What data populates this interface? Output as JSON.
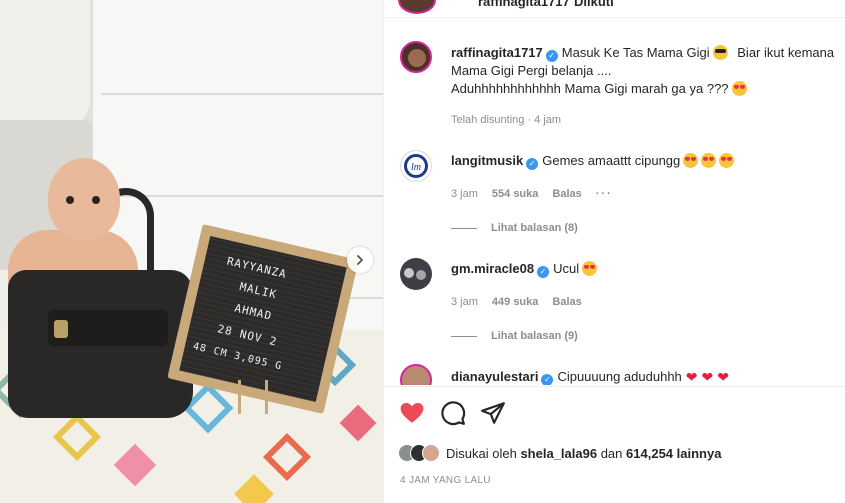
{
  "header": {
    "username": "raffinagita1717",
    "follow_state": "Diikuti"
  },
  "photo": {
    "board_lines": [
      "RAYYANZA",
      "MALIK",
      "AHMAD",
      "28 NOV 2",
      "48 CM   3,095 G"
    ]
  },
  "caption": {
    "username": "raffinagita1717",
    "line1": "Masuk Ke Tas Mama Gigi",
    "line1b": "Biar ikut kemana",
    "line2": "Mama Gigi Pergi belanja ....",
    "line3": "Aduhhhhhhhhhhhh Mama Gigi marah ga ya ???",
    "meta": "Telah disunting · 4 jam"
  },
  "comments": [
    {
      "username": "langitmusik",
      "text": "Gemes amaattt cipungg",
      "time": "3 jam",
      "likes": "554 suka",
      "reply_label": "Balas",
      "view_replies": "Lihat balasan (8)"
    },
    {
      "username": "gm.miracle08",
      "text": "Ucul",
      "time": "3 jam",
      "likes": "449 suka",
      "reply_label": "Balas",
      "view_replies": "Lihat balasan (9)"
    },
    {
      "username": "dianayulestari",
      "text": "Cipuuuung aduduhhh"
    }
  ],
  "actions": {
    "like_icon": "heart-filled-icon",
    "comment_icon": "comment-bubble-icon",
    "share_icon": "paper-plane-icon",
    "liked_by_prefix": "Disukai oleh",
    "liked_by_user": "shela_lala96",
    "liked_by_and": "dan",
    "liked_by_count": "614,254 lainnya",
    "time_ago": "4 JAM YANG LALU"
  },
  "colors": {
    "like_red": "#ed4956",
    "verified_blue": "#3897f0",
    "muted_text": "#8e8e8e"
  }
}
